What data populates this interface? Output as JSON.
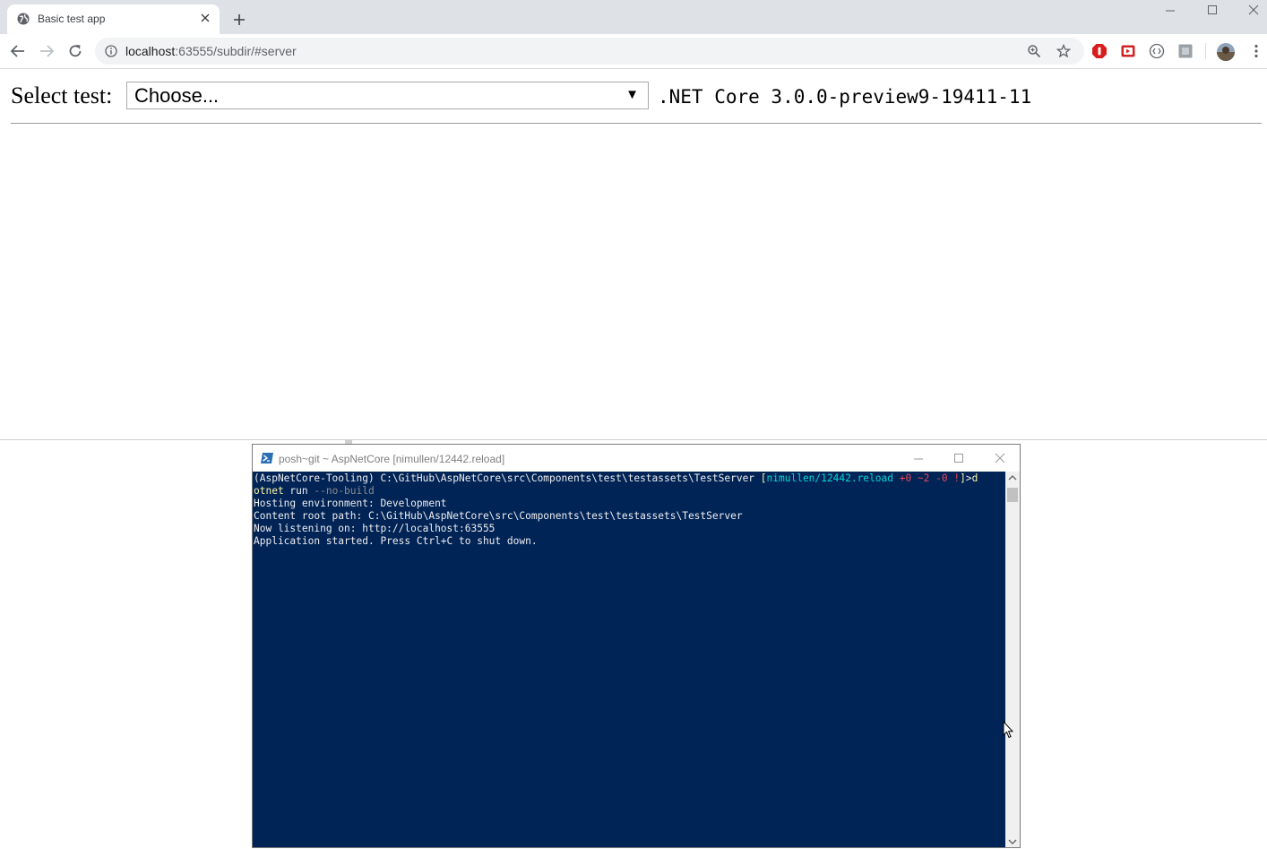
{
  "browser": {
    "tab_title": "Basic test app",
    "url_host": "localhost",
    "url_rest": ":63555/subdir/#server"
  },
  "page": {
    "select_label": "Select test:",
    "select_value": "Choose...",
    "version": ".NET Core 3.0.0-preview9-19411-11"
  },
  "console": {
    "title": "posh~git ~ AspNetCore [nimullen/12442.reload]",
    "prompt_prefix": "(AspNetCore-Tooling) C:\\GitHub\\AspNetCore\\src\\Components\\test\\testassets\\TestServer ",
    "git_open": "[",
    "git_branch": "nimullen/12442.reload",
    "git_status": " +0 ~2 -0 !",
    "git_close": "]",
    "prompt_gt": ">",
    "cmd_part1": "d",
    "cmd_part2": "otnet",
    "cmd_part3": " run ",
    "cmd_part4": "--no-build",
    "line3": "Hosting environment: Development",
    "line4": "Content root path: C:\\GitHub\\AspNetCore\\src\\Components\\test\\testassets\\TestServer",
    "line5": "Now listening on: http://localhost:63555",
    "line6": "Application started. Press Ctrl+C to shut down."
  },
  "colors": {
    "console_bg": "#012456",
    "tabstrip_bg": "#dee1e6",
    "git_cyan": "#00d7d7",
    "git_red": "#e74856",
    "cmd_yellow": "#f9f1a5"
  },
  "icons": {
    "tab_favicon": "globe-icon",
    "tab_close": "close-icon",
    "new_tab": "plus-icon",
    "back": "back-arrow-icon",
    "forward": "forward-arrow-icon",
    "reload": "reload-icon",
    "site_info": "info-icon",
    "zoom": "zoom-icon",
    "bookmark": "star-icon",
    "menu": "kebab-menu-icon"
  }
}
